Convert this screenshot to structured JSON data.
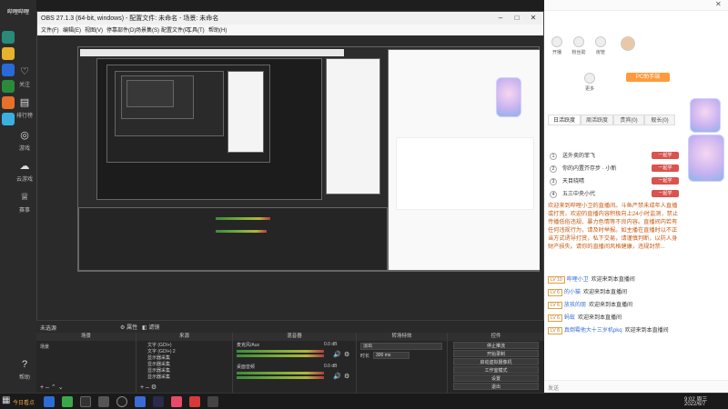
{
  "sidebar": {
    "logo": "哔哩哔哩",
    "items": [
      {
        "label": "关注",
        "icon": "heart-icon"
      },
      {
        "label": "排行榜",
        "icon": "chart-icon"
      },
      {
        "label": "游戏",
        "icon": "gamepad-icon"
      },
      {
        "label": "云游戏",
        "icon": "cloud-icon"
      },
      {
        "label": "赛事",
        "icon": "trophy-icon"
      }
    ],
    "bottom": [
      "帮助"
    ]
  },
  "obs": {
    "title": "OBS 27.1.3 (64-bit, windows) - 配置文件: 未命名 - 场景: 未命名",
    "menu": [
      "文件(F)",
      "编辑(E)",
      "视图(V)",
      "停靠部件(D)",
      "场景集(S)",
      "配置文件(P)",
      "工具(T)",
      "帮助(H)"
    ],
    "no_source_label": "未选源",
    "props_btn": "属性",
    "filter_btn": "滤镜",
    "docks": {
      "scenes": {
        "header": "场景",
        "items": [
          "场景"
        ]
      },
      "sources": {
        "header": "来源",
        "items": [
          "文字 (GDI+)",
          "文字 (GDI+) 2",
          "显示器采集",
          "显示器采集",
          "显示器采集",
          "显示器采集"
        ]
      },
      "mixer": {
        "header": "混音器",
        "tracks": [
          {
            "name": "麦克风/Aux",
            "value": "0.0 dB"
          },
          {
            "name": "桌面音频",
            "value": "0.0 dB"
          }
        ]
      },
      "transitions": {
        "header": "转场特效",
        "type": "淡出",
        "duration_label": "时长",
        "duration": "300 ms"
      },
      "controls": {
        "header": "控件",
        "buttons": [
          "停止推流",
          "开始录制",
          "启动虚拟摄像机",
          "工作室模式",
          "设置",
          "退出"
        ]
      }
    },
    "status": {
      "live": "LIVE: 00:01:01",
      "rec": "REC: 00:00:00",
      "cpu": "CPU: 7.8%, 30.00 fps",
      "kbps": "kb/s: 2498"
    }
  },
  "chat": {
    "top_icons": [
      "开播",
      "粉丝勋",
      "房管",
      "更多"
    ],
    "pc_button": "PC助手端",
    "tabs": [
      "日活跃度",
      "周活跃度",
      "贵宾(0)",
      "舰长(0)"
    ],
    "rank_rows": [
      {
        "num": "1",
        "name": "送外卖的菲飞",
        "tag": "一起学"
      },
      {
        "num": "2",
        "name": "你的内置芥存步 · 小新",
        "tag": "一起学"
      },
      {
        "num": "3",
        "name": "天目晓晴",
        "tag": "一起学"
      },
      {
        "num": "4",
        "name": "五三中央小代",
        "tag": "一起学"
      }
    ],
    "notice": "欢迎来到哔哩小卫的直播间。斗鱼严禁未成年人直播或打赏，欢迎的直播内容积极向上24小时监测，禁止传播低俗违规、暴力色情等不良内容。直播间内若有任何违规行为，请及时举报。如主播在直播时以不正当方式诱导打赏，私下交易，请谨慎判断，以防人身财产损失。请你的直播间风格健康，违规封禁...",
    "messages": [
      {
        "lv": "LV 10",
        "name": "哔哩小卫",
        "text": "欢迎来到本直播间"
      },
      {
        "lv": "LV 6",
        "name": "的小猫",
        "text": "欢迎来到本直播间"
      },
      {
        "lv": "LV 6",
        "name": "放孩的朋",
        "text": "欢迎来到本直播间"
      },
      {
        "lv": "LV 6",
        "name": "蚂蚁",
        "text": "欢迎来到本直播间"
      },
      {
        "lv": "LV 8",
        "name": "真倒霉他大十三岁机pkq",
        "text": "欢迎来到本直播间"
      }
    ],
    "send_hint": "发送"
  },
  "taskbar": {
    "weather": "今日看点",
    "time": "9:02 周三",
    "date": "2022/6/7"
  }
}
